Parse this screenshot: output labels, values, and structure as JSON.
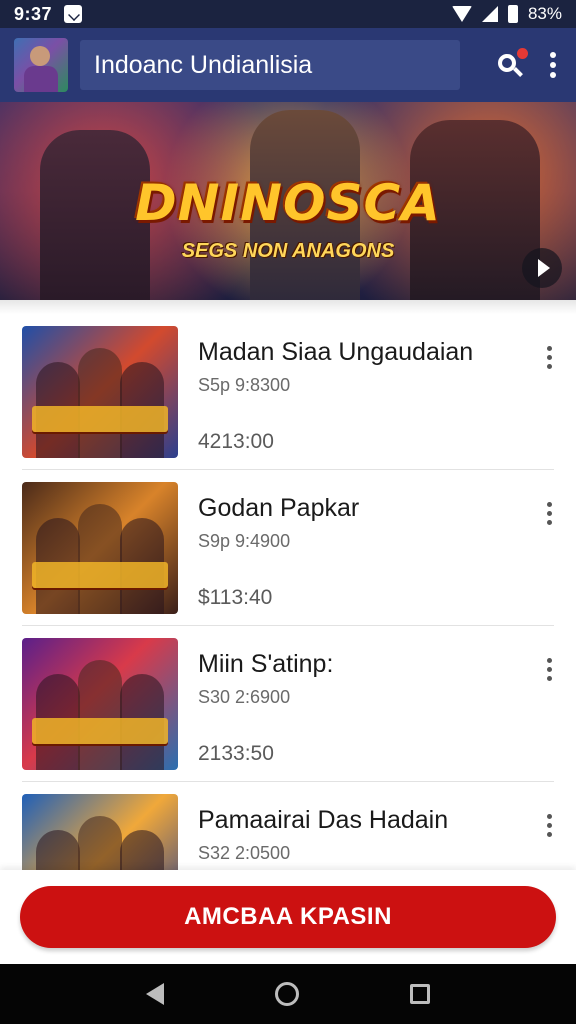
{
  "status_bar": {
    "time": "9:37",
    "battery": "83%"
  },
  "app_bar": {
    "title": "Indoanc Undianlisia"
  },
  "hero": {
    "title": "DNINOSCA",
    "subtitle": "SEGS NON ANAGONS"
  },
  "games": [
    {
      "title": "Madan Siaa Ungaudaian",
      "meta": "S5p 9:8300",
      "price": "4213:00"
    },
    {
      "title": "Godan Papkar",
      "meta": "S9p 9:4900",
      "price": "$113:40"
    },
    {
      "title": "Miin S'atinp:",
      "meta": "S30 2:6900",
      "price": "2133:50"
    },
    {
      "title": "Pamaairai Das Hadain",
      "meta": "S32 2:0500",
      "price": ""
    }
  ],
  "cta": {
    "label": "AMCBAA KPASIN"
  },
  "colors": {
    "app_bar": "#2a3873",
    "cta": "#cc1111",
    "status_bar": "#1b2340"
  }
}
